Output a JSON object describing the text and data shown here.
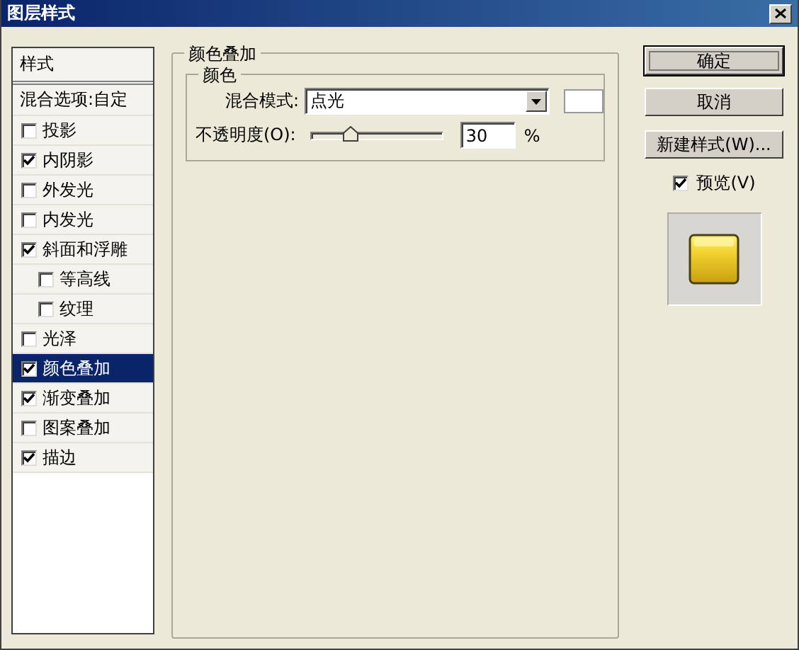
{
  "window": {
    "title": "图层样式"
  },
  "styles_panel": {
    "header": "样式",
    "blending_options": "混合选项:自定",
    "items": [
      {
        "label": "投影",
        "checked": false,
        "selected": false
      },
      {
        "label": "内阴影",
        "checked": true,
        "selected": false
      },
      {
        "label": "外发光",
        "checked": false,
        "selected": false
      },
      {
        "label": "内发光",
        "checked": false,
        "selected": false
      },
      {
        "label": "斜面和浮雕",
        "checked": true,
        "selected": false,
        "children": [
          {
            "label": "等高线",
            "checked": false,
            "selected": false
          },
          {
            "label": "纹理",
            "checked": false,
            "selected": false
          }
        ]
      },
      {
        "label": "光泽",
        "checked": false,
        "selected": false
      },
      {
        "label": "颜色叠加",
        "checked": true,
        "selected": true
      },
      {
        "label": "渐变叠加",
        "checked": true,
        "selected": false
      },
      {
        "label": "图案叠加",
        "checked": false,
        "selected": false
      },
      {
        "label": "描边",
        "checked": true,
        "selected": false
      }
    ]
  },
  "color_overlay": {
    "title": "颜色叠加",
    "group": "颜色",
    "blend_mode_label": "混合模式:",
    "blend_mode": "点光",
    "color": "#ffffff",
    "opacity_label": "不透明度(O):",
    "opacity": {
      "level": 0.3
    },
    "opacity_value": "30",
    "percent": "%"
  },
  "buttons": [
    {
      "label": "确定",
      "default": true
    },
    {
      "label": "取消",
      "default": false
    },
    {
      "label": "新建样式(W)...",
      "default": false
    }
  ],
  "preview": {
    "label": "预览(V)",
    "checked": true
  }
}
